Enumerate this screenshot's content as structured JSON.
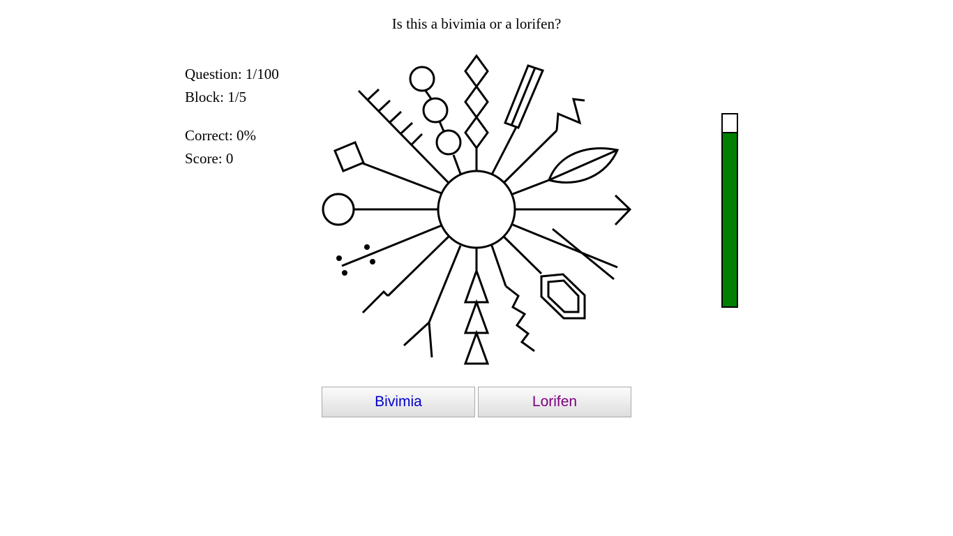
{
  "prompt": "Is this a bivimia or a lorifen?",
  "stats": {
    "question": "Question: 1/100",
    "block": "Block: 1/5",
    "correct": "Correct: 0%",
    "score": "Score: 0"
  },
  "meter": {
    "level": 0.91,
    "fill_color": "#008000"
  },
  "buttons": {
    "bivimia": {
      "label": "Bivimia",
      "color": "#0000cc"
    },
    "lorifen": {
      "label": "Lorifen",
      "color": "#800080"
    }
  }
}
